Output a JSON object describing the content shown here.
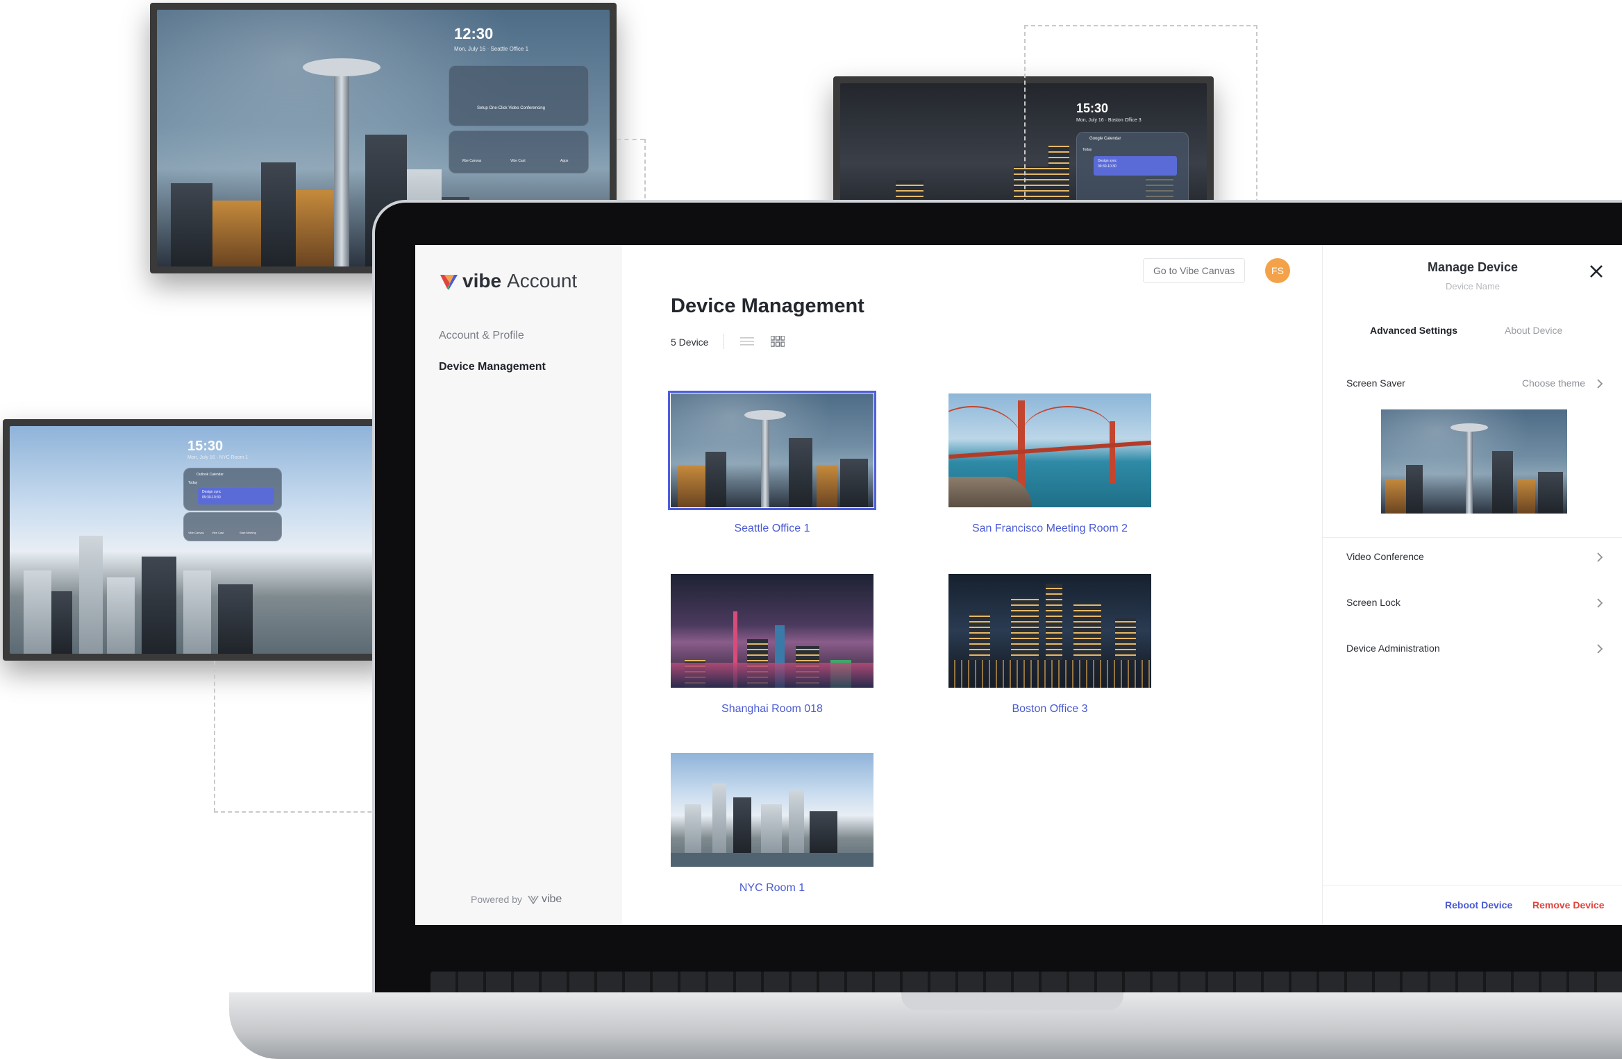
{
  "tvs": {
    "seattle": {
      "time": "12:30",
      "date": "Mon, July 16  ·  Seattle Office 1",
      "setup_label": "Setup One-Click Video Conferencing",
      "apps": [
        "Vibe Canvas",
        "Vibe Cast",
        "Apps"
      ]
    },
    "boston": {
      "time": "15:30",
      "date": "Mon, July 16  ·  Boston Office 3",
      "calendar": "Google Calendar",
      "today": "Today",
      "event": "Design sync",
      "event_time": "09:30-10:30"
    },
    "nyc": {
      "time": "15:30",
      "date": "Mon, July 16  ·  NYC Room 1",
      "calendar": "Outlook Calendar",
      "today": "Today",
      "event": "Design sync",
      "event_time": "09:30-10:30",
      "apps": [
        "Vibe Canvas",
        "Vibe Cast",
        "Start Meeting"
      ]
    }
  },
  "sidebar": {
    "brand": "vibe",
    "brand_suffix": "Account",
    "items": [
      {
        "label": "Account & Profile"
      },
      {
        "label": "Device Management"
      }
    ],
    "powered_by": "Powered by",
    "powered_brand": "vibe"
  },
  "header": {
    "goto_label": "Go to Vibe Canvas",
    "avatar_initials": "FS"
  },
  "main": {
    "title": "Device Management",
    "device_count": "5 Device",
    "devices": [
      {
        "name": "Seattle Office 1",
        "selected": true
      },
      {
        "name": "San Francisco Meeting Room 2",
        "selected": false
      },
      {
        "name": "Shanghai Room 018",
        "selected": false
      },
      {
        "name": "Boston Office 3",
        "selected": false
      },
      {
        "name": "NYC Room 1",
        "selected": false
      }
    ]
  },
  "panel": {
    "title": "Manage Device",
    "subtitle": "Device Name",
    "tabs": [
      "Advanced Settings",
      "About Device"
    ],
    "screen_saver": "Screen Saver",
    "choose_theme": "Choose theme",
    "rows": [
      "Video Conference",
      "Screen Lock",
      "Device Administration"
    ],
    "reboot": "Reboot Device",
    "remove": "Remove Device"
  },
  "colors": {
    "accent": "#4a5bd4",
    "danger": "#e0443e",
    "avatar": "#f3a24a"
  }
}
